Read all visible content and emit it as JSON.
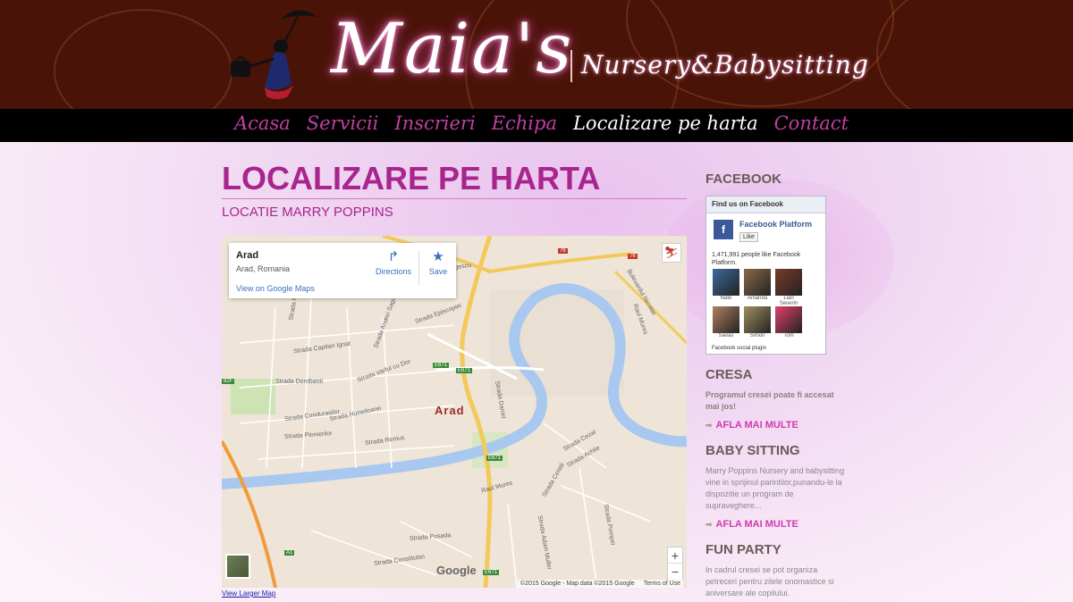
{
  "header": {
    "logo_title": "Maia's",
    "logo_subtitle": "Nursery&Babysitting"
  },
  "nav": {
    "items": [
      {
        "label": "Acasa",
        "active": false
      },
      {
        "label": "Servicii",
        "active": false
      },
      {
        "label": "Inscrieri",
        "active": false
      },
      {
        "label": "Echipa",
        "active": false
      },
      {
        "label": "Localizare pe harta",
        "active": true
      },
      {
        "label": "Contact",
        "active": false
      }
    ]
  },
  "main": {
    "title": "LOCALIZARE PE HARTA",
    "subtitle": "LOCATIE MARRY POPPINS",
    "view_larger": "View Larger Map"
  },
  "map": {
    "place_name": "Arad",
    "place_address": "Arad, Romania",
    "view_link": "View on Google Maps",
    "directions": "Directions",
    "save": "Save",
    "city_label": "Arad",
    "google": "Google",
    "attribution": "©2015 Google - Map data ©2015 Google",
    "terms": "Terms of Use",
    "zoom_in": "+",
    "zoom_out": "−",
    "streets": [
      "Splaiul General Praporgescu",
      "Bulevardul Nicolae",
      "Raul Mures",
      "Strada Paduri",
      "Strada Andrei Saguna",
      "Strada Episcopiei",
      "Strada Capitan Ignat",
      "Strada Varful cu Dor",
      "Strada Dorobanti",
      "Strada Condurasilor",
      "Strada Hunedoarei",
      "Strada Pionierilor",
      "Strada Remus",
      "Strada Daniel",
      "Strada Cezar",
      "Strada Achile",
      "Raul Mures",
      "Strada Cetatii",
      "Strada Posada",
      "Strada Constitutiei",
      "Strada Adam Muller",
      "Strada Pompei"
    ],
    "routes": [
      "76",
      "76",
      "E671",
      "E671",
      "E671",
      "A1",
      "E671",
      "82F"
    ]
  },
  "sidebar": {
    "facebook_heading": "FACEBOOK",
    "fb_find": "Find us on Facebook",
    "fb_page": "Facebook Platform",
    "fb_like": "Like",
    "fb_count": "1,471,991 people like Facebook Platform.",
    "fb_faces": [
      {
        "name": "Nate",
        "color": "#3a6a9a"
      },
      {
        "name": "Amanda",
        "color": "#8a6a4a"
      },
      {
        "name": "Lian Severin",
        "color": "#7a3a2a"
      },
      {
        "name": "Savas",
        "color": "#b08060"
      },
      {
        "name": "Simon",
        "color": "#a09060"
      },
      {
        "name": "Tom",
        "color": "#e0406a"
      }
    ],
    "fb_plugin": "Facebook social plugin",
    "cresa_heading": "CRESA",
    "cresa_text": "Programul cresei poate fi accesat mai jos!",
    "more_label": "AFLA MAI MULTE",
    "baby_heading": "BABY SITTING",
    "baby_text": "Marry Poppins Nursery and babysitting vine in sprijinul parintilor,punandu-le la dispozitie un program de supraveghere...",
    "party_heading": "FUN PARTY",
    "party_text": "In cadrul cresei se pot organiza petreceri pentru zilele onomastice si aniversare ale copilului."
  },
  "colors": {
    "header_bg": "#4a1308",
    "nav_bg": "#000000",
    "accent": "#a8258e",
    "link_pink": "#cf3ab0"
  }
}
